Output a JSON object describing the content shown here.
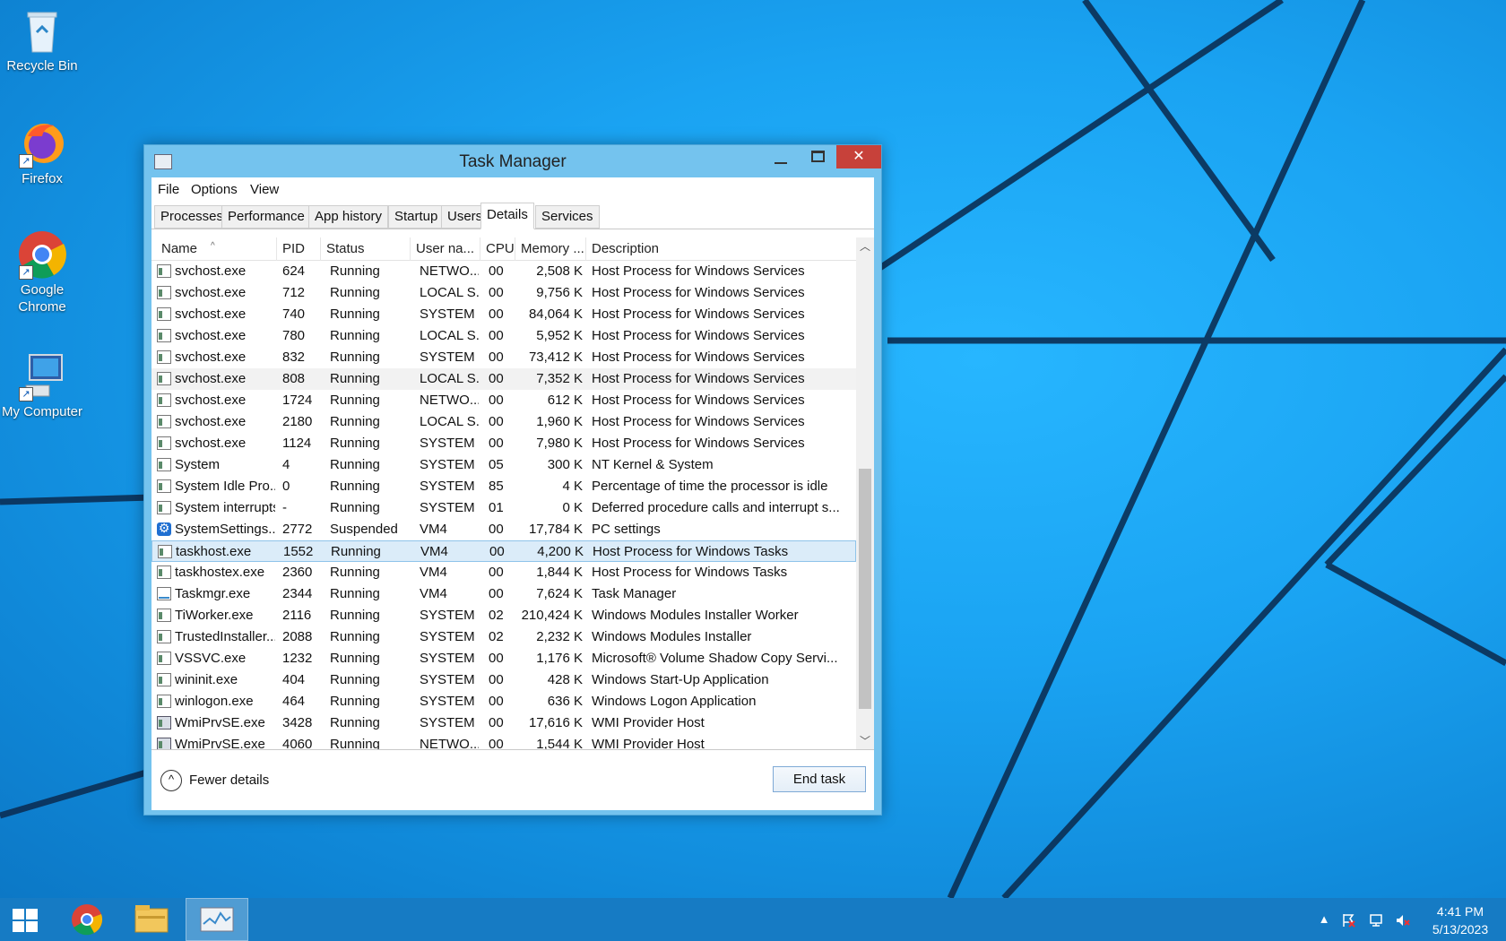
{
  "desktop": {
    "icons": [
      {
        "label": "Recycle Bin",
        "icon": "recycle-bin-icon"
      },
      {
        "label": "Firefox",
        "icon": "firefox-icon"
      },
      {
        "label": "Google Chrome",
        "icon": "chrome-icon"
      },
      {
        "label": "My Computer",
        "icon": "computer-icon"
      }
    ]
  },
  "window": {
    "title": "Task Manager",
    "close_glyph": "✕",
    "menu": [
      "File",
      "Options",
      "View"
    ],
    "tabs": [
      "Processes",
      "Performance",
      "App history",
      "Startup",
      "Users",
      "Details",
      "Services"
    ],
    "active_tab": "Details",
    "columns": [
      "Name",
      "PID",
      "Status",
      "User na...",
      "CPU",
      "Memory ...",
      "Description"
    ],
    "sort_indicator": "^",
    "rows": [
      {
        "name": "svchost.exe",
        "pid": "624",
        "status": "Running",
        "user": "NETWO...",
        "cpu": "00",
        "memory": "2,508 K",
        "description": "Host Process for Windows Services",
        "icon": "process-icon"
      },
      {
        "name": "svchost.exe",
        "pid": "712",
        "status": "Running",
        "user": "LOCAL S...",
        "cpu": "00",
        "memory": "9,756 K",
        "description": "Host Process for Windows Services",
        "icon": "process-icon"
      },
      {
        "name": "svchost.exe",
        "pid": "740",
        "status": "Running",
        "user": "SYSTEM",
        "cpu": "00",
        "memory": "84,064 K",
        "description": "Host Process for Windows Services",
        "icon": "process-icon"
      },
      {
        "name": "svchost.exe",
        "pid": "780",
        "status": "Running",
        "user": "LOCAL S...",
        "cpu": "00",
        "memory": "5,952 K",
        "description": "Host Process for Windows Services",
        "icon": "process-icon"
      },
      {
        "name": "svchost.exe",
        "pid": "832",
        "status": "Running",
        "user": "SYSTEM",
        "cpu": "00",
        "memory": "73,412 K",
        "description": "Host Process for Windows Services",
        "icon": "process-icon"
      },
      {
        "name": "svchost.exe",
        "pid": "808",
        "status": "Running",
        "user": "LOCAL S...",
        "cpu": "00",
        "memory": "7,352 K",
        "description": "Host Process for Windows Services",
        "icon": "process-icon",
        "state": "hover"
      },
      {
        "name": "svchost.exe",
        "pid": "1724",
        "status": "Running",
        "user": "NETWO...",
        "cpu": "00",
        "memory": "612 K",
        "description": "Host Process for Windows Services",
        "icon": "process-icon"
      },
      {
        "name": "svchost.exe",
        "pid": "2180",
        "status": "Running",
        "user": "LOCAL S...",
        "cpu": "00",
        "memory": "1,960 K",
        "description": "Host Process for Windows Services",
        "icon": "process-icon"
      },
      {
        "name": "svchost.exe",
        "pid": "1124",
        "status": "Running",
        "user": "SYSTEM",
        "cpu": "00",
        "memory": "7,980 K",
        "description": "Host Process for Windows Services",
        "icon": "process-icon"
      },
      {
        "name": "System",
        "pid": "4",
        "status": "Running",
        "user": "SYSTEM",
        "cpu": "05",
        "memory": "300 K",
        "description": "NT Kernel & System",
        "icon": "process-icon"
      },
      {
        "name": "System Idle Pro...",
        "pid": "0",
        "status": "Running",
        "user": "SYSTEM",
        "cpu": "85",
        "memory": "4 K",
        "description": "Percentage of time the processor is idle",
        "icon": "process-icon"
      },
      {
        "name": "System interrupts",
        "pid": "-",
        "status": "Running",
        "user": "SYSTEM",
        "cpu": "01",
        "memory": "0 K",
        "description": "Deferred procedure calls and interrupt s...",
        "icon": "process-icon"
      },
      {
        "name": "SystemSettings....",
        "pid": "2772",
        "status": "Suspended",
        "user": "VM4",
        "cpu": "00",
        "memory": "17,784 K",
        "description": "PC settings",
        "icon": "settings-gear-icon"
      },
      {
        "name": "taskhost.exe",
        "pid": "1552",
        "status": "Running",
        "user": "VM4",
        "cpu": "00",
        "memory": "4,200 K",
        "description": "Host Process for Windows Tasks",
        "icon": "process-icon",
        "state": "selected"
      },
      {
        "name": "taskhostex.exe",
        "pid": "2360",
        "status": "Running",
        "user": "VM4",
        "cpu": "00",
        "memory": "1,844 K",
        "description": "Host Process for Windows Tasks",
        "icon": "process-icon"
      },
      {
        "name": "Taskmgr.exe",
        "pid": "2344",
        "status": "Running",
        "user": "VM4",
        "cpu": "00",
        "memory": "7,624 K",
        "description": "Task Manager",
        "icon": "task-manager-icon"
      },
      {
        "name": "TiWorker.exe",
        "pid": "2116",
        "status": "Running",
        "user": "SYSTEM",
        "cpu": "02",
        "memory": "210,424 K",
        "description": "Windows Modules Installer Worker",
        "icon": "process-icon"
      },
      {
        "name": "TrustedInstaller....",
        "pid": "2088",
        "status": "Running",
        "user": "SYSTEM",
        "cpu": "02",
        "memory": "2,232 K",
        "description": "Windows Modules Installer",
        "icon": "process-icon"
      },
      {
        "name": "VSSVC.exe",
        "pid": "1232",
        "status": "Running",
        "user": "SYSTEM",
        "cpu": "00",
        "memory": "1,176 K",
        "description": "Microsoft® Volume Shadow Copy Servi...",
        "icon": "process-icon"
      },
      {
        "name": "wininit.exe",
        "pid": "404",
        "status": "Running",
        "user": "SYSTEM",
        "cpu": "00",
        "memory": "428 K",
        "description": "Windows Start-Up Application",
        "icon": "process-icon"
      },
      {
        "name": "winlogon.exe",
        "pid": "464",
        "status": "Running",
        "user": "SYSTEM",
        "cpu": "00",
        "memory": "636 K",
        "description": "Windows Logon Application",
        "icon": "process-icon"
      },
      {
        "name": "WmiPrvSE.exe",
        "pid": "3428",
        "status": "Running",
        "user": "SYSTEM",
        "cpu": "00",
        "memory": "17,616 K",
        "description": "WMI Provider Host",
        "icon": "wmi-provider-icon"
      },
      {
        "name": "WmiPrvSE.exe",
        "pid": "4060",
        "status": "Running",
        "user": "NETWO...",
        "cpu": "00",
        "memory": "1,544 K",
        "description": "WMI Provider Host",
        "icon": "wmi-provider-icon"
      }
    ],
    "footer": {
      "fewer_details": "Fewer details",
      "fewer_glyph": "^",
      "end_task": "End task"
    }
  },
  "taskbar": {
    "apps": [
      "start-icon",
      "chrome-icon",
      "file-explorer-icon",
      "task-manager-icon"
    ],
    "tray": [
      "show-hidden-icons-icon",
      "action-center-flag-icon",
      "network-icon",
      "speaker-muted-icon"
    ],
    "clock": {
      "time": "4:41 PM",
      "date": "5/13/2023"
    }
  },
  "colors": {
    "desktop": "#1aa3f2",
    "taskbar": "#167bc4",
    "close_button": "#c7413a",
    "selection": "#dbecf9"
  }
}
